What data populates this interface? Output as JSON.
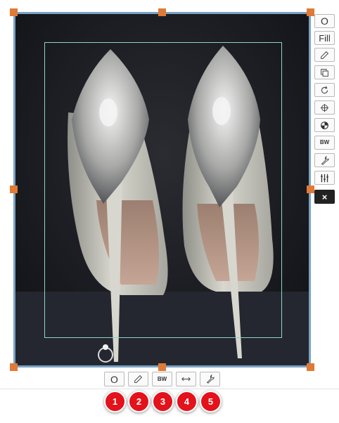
{
  "side_toolbar": {
    "items": [
      {
        "label": "O",
        "name": "original"
      },
      {
        "label": "Fill",
        "name": "fill"
      },
      {
        "label": "",
        "icon": "pencil-icon"
      },
      {
        "label": "",
        "icon": "copy-icon"
      },
      {
        "label": "",
        "icon": "rotate-icon"
      },
      {
        "label": "",
        "icon": "crosshair-icon"
      },
      {
        "label": "",
        "icon": "contrast-icon"
      },
      {
        "label": "BW",
        "name": "black-white"
      },
      {
        "label": "",
        "icon": "wrench-icon"
      },
      {
        "label": "",
        "icon": "sliders-icon"
      },
      {
        "label": "×",
        "name": "close"
      }
    ]
  },
  "bottom_toolbar": {
    "original_label": "O",
    "bw_label": "BW",
    "icons": [
      "pencil-icon",
      "resize-horizontal-icon",
      "wrench-icon"
    ]
  },
  "callouts": [
    "1",
    "2",
    "3",
    "4",
    "5"
  ],
  "colors": {
    "frame_border": "#7aa2c4",
    "handle": "#e07a36",
    "crop_guide": "#8fd4c6",
    "callout_badge": "#e3121b"
  }
}
